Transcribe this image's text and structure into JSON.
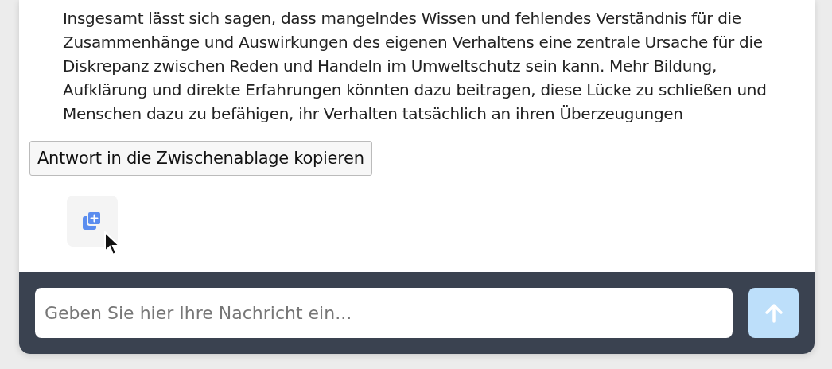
{
  "message": {
    "text": "Insgesamt lässt sich sagen, dass mangelndes Wissen und fehlendes Verständnis für die Zusammenhänge und Auswirkungen des eigenen Verhaltens eine zentrale Ursache für die Diskrepanz zwischen Reden und Handeln im Umweltschutz sein kann. Mehr Bildung, Aufklärung und direkte Erfahrungen könnten dazu beitragen, diese Lücke zu schließen und Menschen dazu zu befähigen, ihr Verhalten tatsächlich an ihren Überzeugungen"
  },
  "tooltip": {
    "text": "Antwort in die Zwischenablage kopieren"
  },
  "composer": {
    "placeholder": "Geben Sie hier Ihre Nachricht ein...",
    "send_button": {
      "disabled": true
    }
  }
}
